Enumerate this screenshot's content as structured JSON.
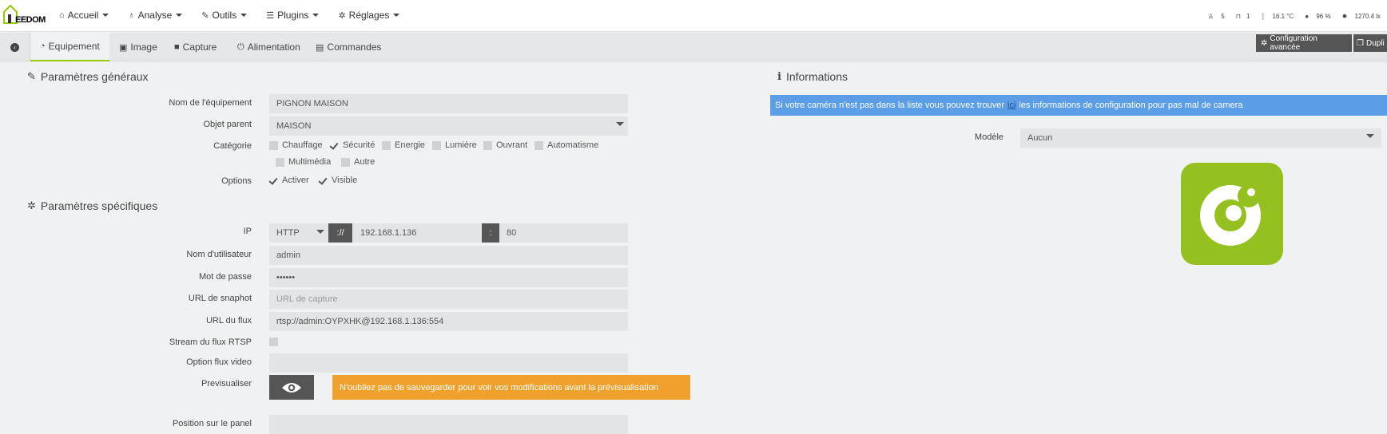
{
  "brand": {
    "logo_text": "EEDOM"
  },
  "nav": [
    {
      "label": "Accueil",
      "icon": "home-icon"
    },
    {
      "label": "Analyse",
      "icon": "stethoscope-icon"
    },
    {
      "label": "Outils",
      "icon": "wrench-icon"
    },
    {
      "label": "Plugins",
      "icon": "list-icon"
    },
    {
      "label": "Réglages",
      "icon": "gear-icon"
    }
  ],
  "status": {
    "motion": "5",
    "doors": "1",
    "temperature": "16.1 °C",
    "humidity": "96 %",
    "lux": "1270.4 lx"
  },
  "tabs": [
    {
      "label": "Equipement",
      "icon": "dashboard-icon",
      "active": true
    },
    {
      "label": "Image",
      "icon": "image-icon"
    },
    {
      "label": "Capture",
      "icon": "video-icon"
    },
    {
      "label": "Alimentation",
      "icon": "power-icon"
    },
    {
      "label": "Commandes",
      "icon": "list-icon"
    }
  ],
  "toolbar": {
    "advanced_config": "Configuration avancée",
    "duplicate": "Dupli"
  },
  "general": {
    "title": "Paramètres généraux",
    "name_label": "Nom de l'équipement",
    "name_value": "PIGNON MAISON",
    "parent_label": "Objet parent",
    "parent_value": "MAISON",
    "category_label": "Catégorie",
    "categories": [
      {
        "label": "Chauffage",
        "checked": false
      },
      {
        "label": "Sécurité",
        "checked": true
      },
      {
        "label": "Energie",
        "checked": false
      },
      {
        "label": "Lumière",
        "checked": false
      },
      {
        "label": "Ouvrant",
        "checked": false
      },
      {
        "label": "Automatisme",
        "checked": false
      },
      {
        "label": "Multimédia",
        "checked": false
      },
      {
        "label": "Autre",
        "checked": false
      }
    ],
    "options_label": "Options",
    "options": [
      {
        "label": "Activer",
        "checked": true
      },
      {
        "label": "Visible",
        "checked": true
      }
    ]
  },
  "specific": {
    "title": "Paramètres spécifiques",
    "ip_label": "IP",
    "protocol": "HTTP",
    "separator": "://",
    "ip_value": "192.168.1.136",
    "port_separator": ":",
    "port_value": "80",
    "user_label": "Nom d'utilisateur",
    "user_value": "admin",
    "password_label": "Mot de passe",
    "password_value": "••••••",
    "snapshot_label": "URL de snaphot",
    "snapshot_placeholder": "URL de capture",
    "stream_label": "URL du flux",
    "stream_value": "rtsp://admin:OYPXHK@192.168.1.136:554",
    "rtsp_label": "Stream du flux RTSP",
    "video_option_label": "Option flux video",
    "video_option_value": "",
    "preview_label": "Previsualiser",
    "preview_warning": "N'oubliez pas de sauvegarder pour voir vos modifications avant la prévisualisation",
    "panel_label": "Position sur le panel"
  },
  "info": {
    "title": "Informations",
    "banner_before": "Si votre caméra n'est pas dans la liste vous pouvez trouver",
    "banner_link": "ici",
    "banner_after": "les informations de configuration pour pas mal de camera",
    "model_label": "Modèle",
    "model_value": "Aucun"
  },
  "colors": {
    "accent": "#94ca02",
    "info_banner": "#5c9ee6",
    "warning_banner": "#f0a02c",
    "dark_button": "#555555",
    "camera_logo": "#94c11f"
  }
}
